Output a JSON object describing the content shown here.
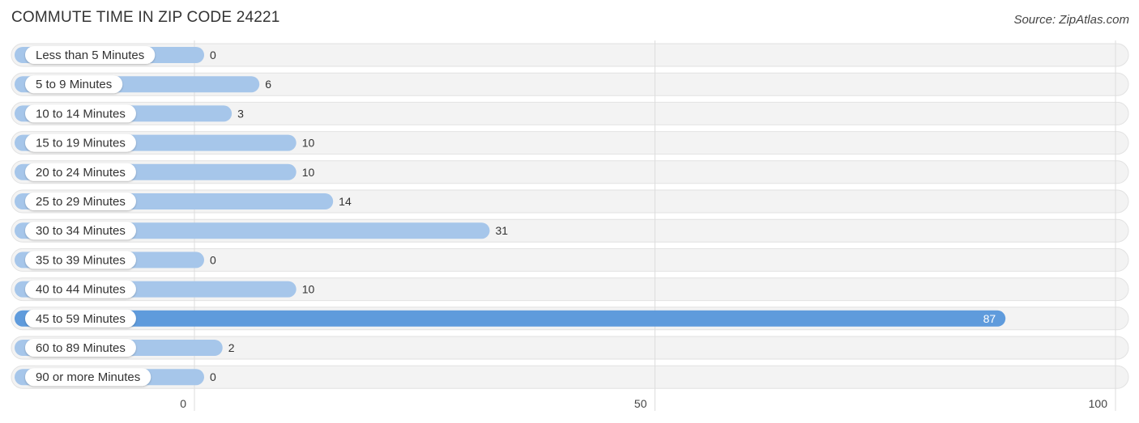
{
  "header": {
    "title": "COMMUTE TIME IN ZIP CODE 24221",
    "source": "Source: ZipAtlas.com"
  },
  "colors": {
    "bar_normal": "#a6c6ea",
    "bar_highlight": "#5f9bdc",
    "track": "#f3f3f3",
    "label_text": "#333333"
  },
  "chart_data": {
    "type": "bar",
    "orientation": "horizontal",
    "title": "COMMUTE TIME IN ZIP CODE 24221",
    "xlabel": "",
    "ylabel": "",
    "xlim": [
      0,
      100
    ],
    "x_ticks": [
      "0",
      "50",
      "100"
    ],
    "grid": true,
    "categories": [
      "Less than 5 Minutes",
      "5 to 9 Minutes",
      "10 to 14 Minutes",
      "15 to 19 Minutes",
      "20 to 24 Minutes",
      "25 to 29 Minutes",
      "30 to 34 Minutes",
      "35 to 39 Minutes",
      "40 to 44 Minutes",
      "45 to 59 Minutes",
      "60 to 89 Minutes",
      "90 or more Minutes"
    ],
    "values": [
      0,
      6,
      3,
      10,
      10,
      14,
      31,
      0,
      10,
      87,
      2,
      0
    ],
    "highlight_index": 9
  }
}
